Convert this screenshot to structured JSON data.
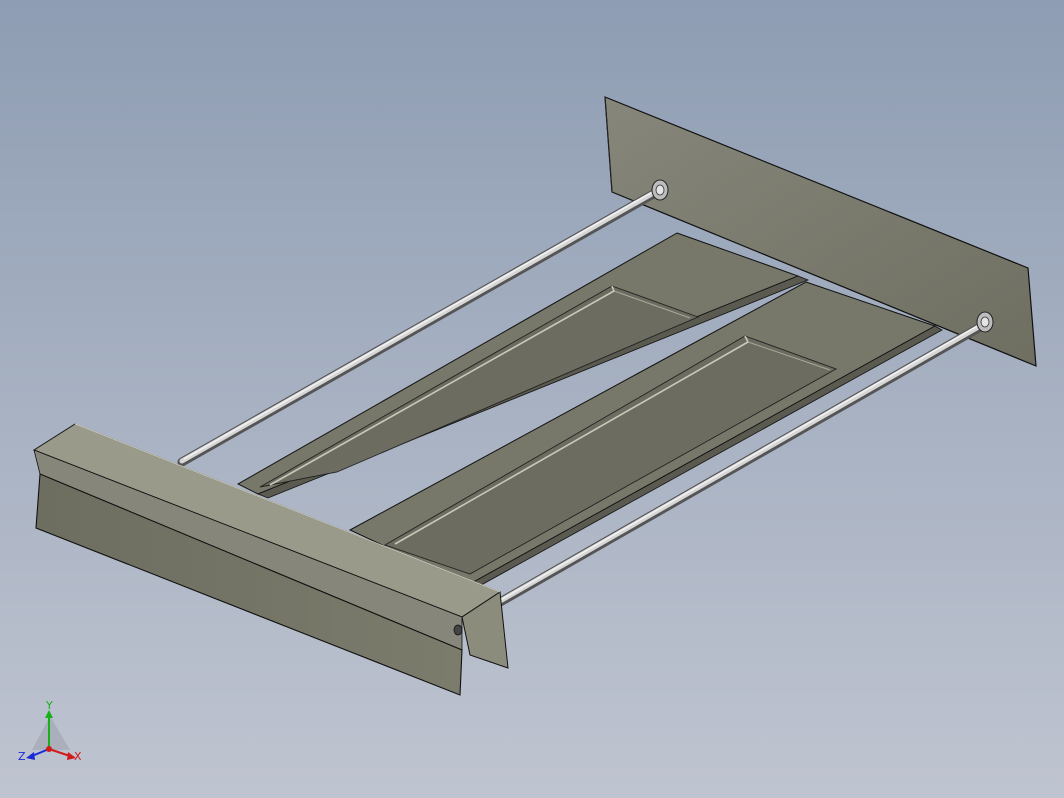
{
  "viewport": {
    "background_top": "#8e9db3",
    "background_bottom": "#bfc4d0",
    "model": "shelf-rack-assembly"
  },
  "colors": {
    "plate": "#7b7b6c",
    "plate_light": "#8a8a7a",
    "edge": "#101010",
    "rod": "#b4b4b4"
  },
  "triad": {
    "x_label": "X",
    "y_label": "Y",
    "z_label": "Z",
    "x_color": "#d21a1a",
    "y_color": "#18b018",
    "z_color": "#1a2ad6"
  }
}
